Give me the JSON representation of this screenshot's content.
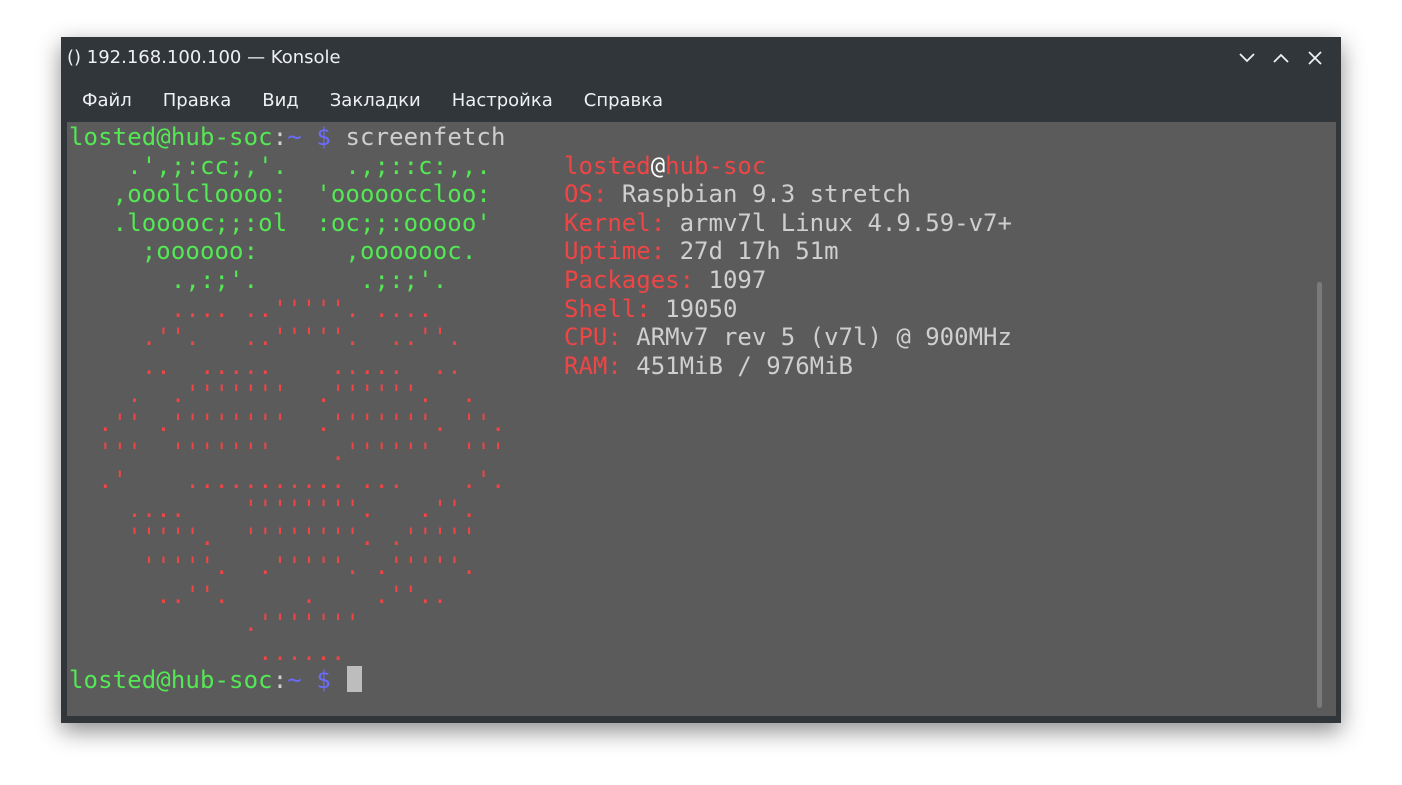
{
  "window": {
    "title": "() 192.168.100.100 — Konsole"
  },
  "menu": [
    "Файл",
    "Правка",
    "Вид",
    "Закладки",
    "Настройка",
    "Справка"
  ],
  "prompt": {
    "user_host": "losted@hub-soc",
    "colon": ":",
    "path": "~",
    "dollar": " $ ",
    "command": "screenfetch"
  },
  "art_green": [
    "    .',;:cc;,'.    .,;::c:,,.",
    "   ,ooolcloooo:  'oooooccloo:",
    "   .looooc;;:ol  :oc;;:ooooo'",
    "     ;oooooo:      ,ooooooc.",
    "       .,:;'.       .;:;'."
  ],
  "art_red": [
    "       .... ..'''''. ....",
    "     .''.   ..'''''.  ..''.",
    "     ..  .....    .....  ..",
    "    .  .'''''''  .''''''.  .",
    "  .'' .''''''''  .'''''''. ''.",
    "  '''  '''''''    .''''''  '''",
    "  .'    ........... ...    .'.",
    "    ....    ''''''''.   .''.",
    "    '''''.  ''''''''. .'''''",
    "     '''''.  .'''''. .'''''.",
    "      ..''.     .    .''..",
    "            .'''''''",
    "             ......"
  ],
  "info": {
    "user": "losted",
    "at": "@",
    "host": "hub-soc",
    "rows": [
      {
        "key": "OS:",
        "value": "Raspbian 9.3 stretch"
      },
      {
        "key": "Kernel:",
        "value": "armv7l Linux 4.9.59-v7+"
      },
      {
        "key": "Uptime:",
        "value": "27d 17h 51m"
      },
      {
        "key": "Packages:",
        "value": "1097"
      },
      {
        "key": "Shell:",
        "value": "19050"
      },
      {
        "key": "CPU:",
        "value": "ARMv7 rev 5 (v7l) @ 900MHz"
      },
      {
        "key": "RAM:",
        "value": "451MiB / 976MiB"
      }
    ]
  },
  "colors": {
    "green": "#54e854",
    "red": "#ef4545",
    "text": "#cfcfcf",
    "blue": "#6b6bff",
    "terminal_bg": "#5b5b5b",
    "window_bg": "#31363b"
  },
  "icons": [
    "minimize-chevron-down-icon",
    "maximize-chevron-up-icon",
    "close-x-icon"
  ]
}
